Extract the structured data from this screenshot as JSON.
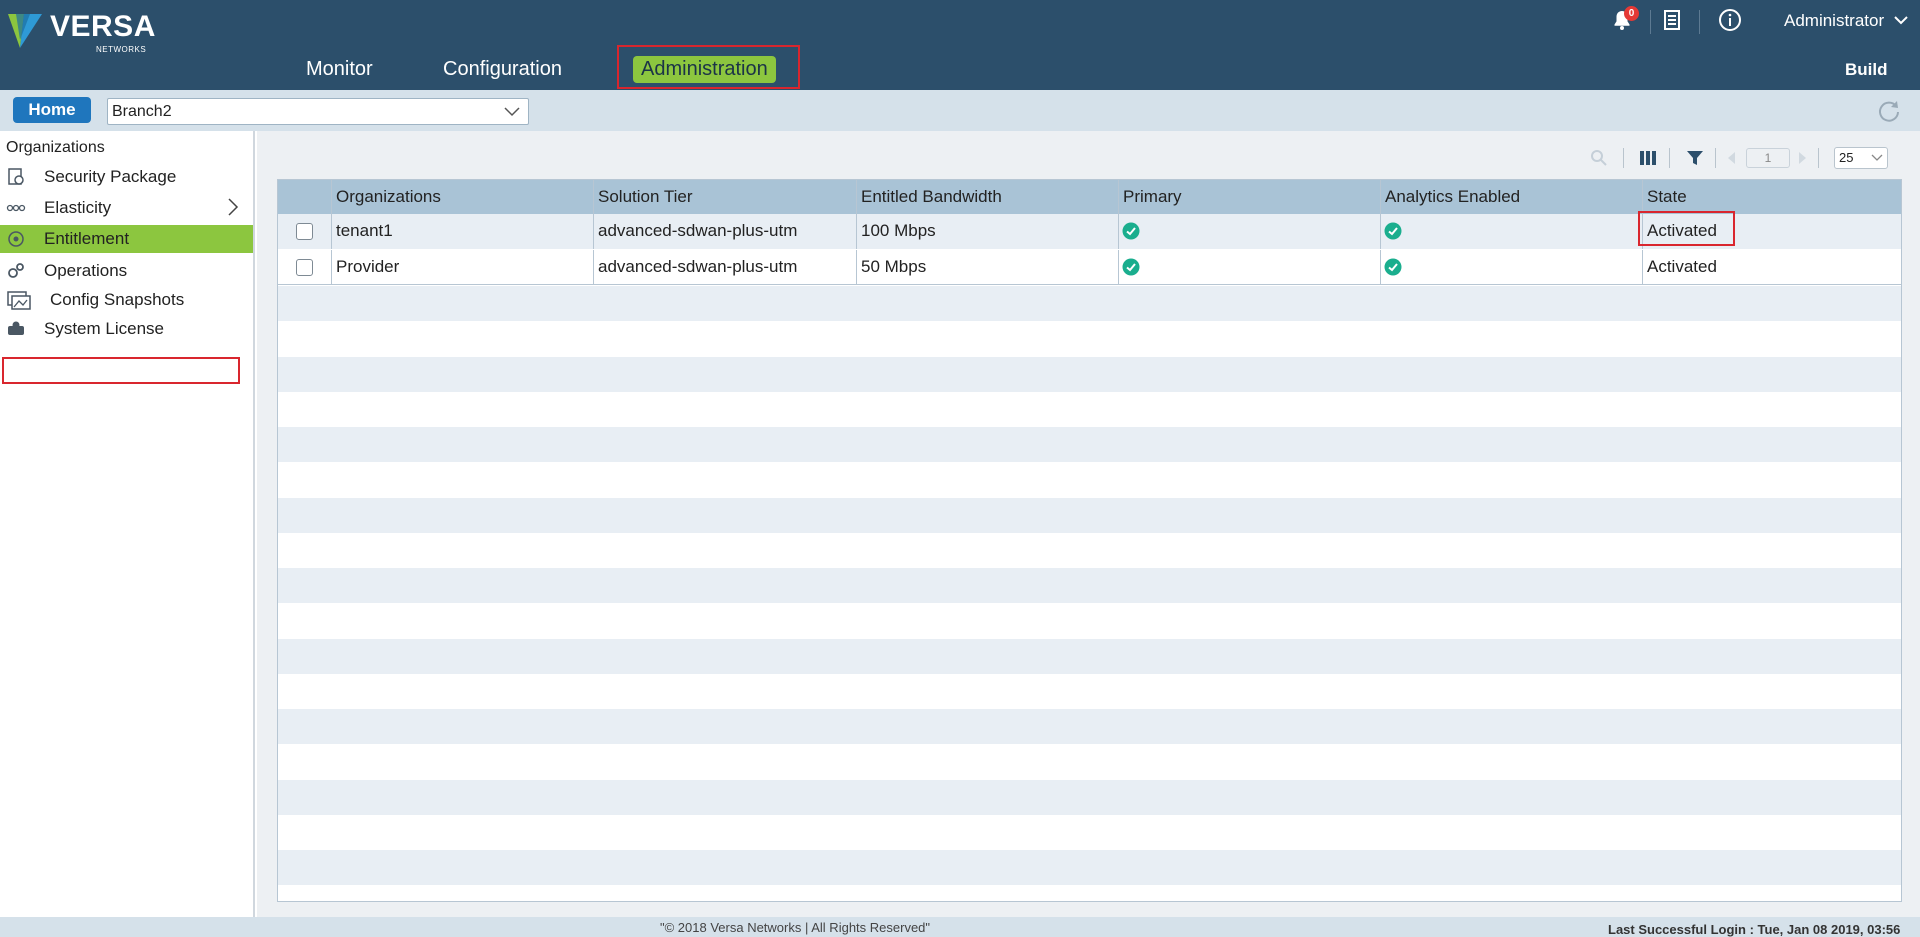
{
  "app": {
    "logo_text": "VERSA",
    "logo_subtext": "NETWORKS",
    "notification_count": "0",
    "user_label": "Administrator",
    "build_label": "Build"
  },
  "nav": {
    "tabs": [
      {
        "label": "Monitor",
        "active": false
      },
      {
        "label": "Configuration",
        "active": false
      },
      {
        "label": "Administration",
        "active": true
      }
    ]
  },
  "subbar": {
    "home_label": "Home",
    "selected_appliance": "Branch2"
  },
  "sidebar": {
    "title": "Organizations",
    "items": [
      {
        "label": "Security Package",
        "icon": "security-package-icon"
      },
      {
        "label": "Elasticity",
        "icon": "elasticity-icon",
        "expandable": true
      },
      {
        "label": "Entitlement",
        "icon": "entitlement-icon",
        "active": true
      },
      {
        "label": "Operations",
        "icon": "operations-icon"
      },
      {
        "label": "Config Snapshots",
        "icon": "config-snapshots-icon"
      },
      {
        "label": "System License",
        "icon": "system-license-icon"
      }
    ]
  },
  "toolbar": {
    "page_number": "1",
    "page_size": "25"
  },
  "table": {
    "columns": [
      "Organizations",
      "Solution Tier",
      "Entitled Bandwidth",
      "Primary",
      "Analytics Enabled",
      "State"
    ],
    "rows": [
      {
        "organization": "tenant1",
        "solution_tier": "advanced-sdwan-plus-utm",
        "bandwidth": "100 Mbps",
        "primary": true,
        "analytics": true,
        "state": "Activated"
      },
      {
        "organization": "Provider",
        "solution_tier": "advanced-sdwan-plus-utm",
        "bandwidth": "50 Mbps",
        "primary": true,
        "analytics": true,
        "state": "Activated"
      }
    ]
  },
  "footer": {
    "copyright": "\"© 2018 Versa Networks | All Rights Reserved\"",
    "last_login": "Last Successful Login : Tue, Jan 08 2019, 03:56"
  },
  "colors": {
    "header_bg": "#2c4f6b",
    "accent_green": "#8cc63f",
    "home_blue": "#1f76bd",
    "highlight_red": "#d9262e",
    "check_teal": "#1aae8e"
  }
}
